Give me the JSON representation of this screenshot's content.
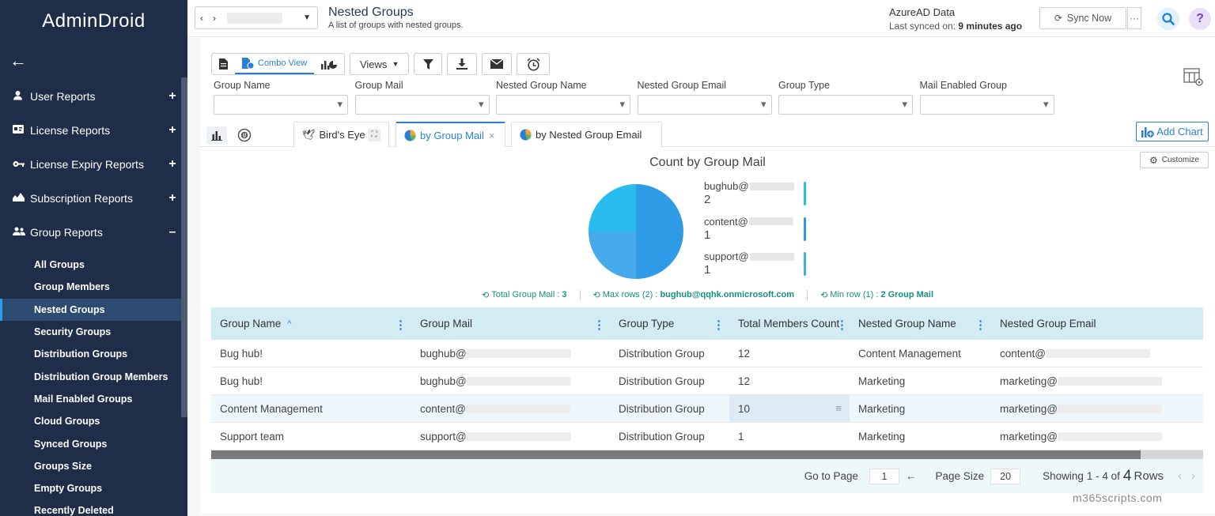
{
  "app": {
    "logo": "AdminDroid",
    "back_icon": "arrow-left-icon"
  },
  "sidebar": {
    "categories": [
      {
        "label": "User Reports",
        "icon": "user-icon",
        "toggle": "+"
      },
      {
        "label": "License Reports",
        "icon": "license-icon",
        "toggle": "+"
      },
      {
        "label": "License Expiry Reports",
        "icon": "key-icon",
        "toggle": "+"
      },
      {
        "label": "Subscription Reports",
        "icon": "subscription-icon",
        "toggle": "+"
      },
      {
        "label": "Group Reports",
        "icon": "group-icon",
        "toggle": "–"
      }
    ],
    "group_items": [
      "All Groups",
      "Group Members",
      "Nested Groups",
      "Security Groups",
      "Distribution Groups",
      "Distribution Group Members",
      "Mail Enabled Groups",
      "Cloud Groups",
      "Synced Groups",
      "Groups Size",
      "Empty Groups",
      "Recently Deleted"
    ],
    "active_item": "Nested Groups"
  },
  "header": {
    "nav_prev": "‹",
    "nav_next": "›",
    "title": "Nested Groups",
    "subtitle": "A list of groups with nested groups.",
    "data_source": "AzureAD Data",
    "last_synced_prefix": "Last synced on:",
    "last_synced_value": "9 minutes ago",
    "sync_button": "Sync Now",
    "more_button": "···",
    "help": "?"
  },
  "toolbar": {
    "combo_view": "Combo View",
    "views": "Views"
  },
  "filters": [
    "Group Name",
    "Group Mail",
    "Nested Group Name",
    "Nested Group Email",
    "Group Type",
    "Mail Enabled Group"
  ],
  "chart_tabs": {
    "birds_eye": "Bird's Eye",
    "tab1": "by Group Mail",
    "tab2": "by Nested Group Email",
    "close": "×"
  },
  "add_chart": "Add Chart",
  "customize": "Customize",
  "chart_data": {
    "type": "pie",
    "title": "Count by Group Mail",
    "categories": [
      "bughub@",
      "content@",
      "support@"
    ],
    "values": [
      2,
      1,
      1
    ],
    "colors": [
      "#2f9be6",
      "#47aaec",
      "#28bdee"
    ],
    "legend": "right"
  },
  "stats": {
    "total_label": "Total Group Mail :",
    "total_value": "3",
    "max_label": "Max rows (2) :",
    "max_value": "bughub@qqhk.onmicrosoft.com",
    "min_label": "Min row (1) :",
    "min_value": "2 Group Mail"
  },
  "table": {
    "columns": [
      "Group Name",
      "Group Mail",
      "Group Type",
      "Total Members Count",
      "Nested Group Name",
      "Nested Group Email"
    ],
    "sort_indicator": "^",
    "rows": [
      [
        "Bug hub!",
        "bughub@",
        "Distribution Group",
        "12",
        "Content Management",
        "content@"
      ],
      [
        "Bug hub!",
        "bughub@",
        "Distribution Group",
        "12",
        "Marketing",
        "marketing@"
      ],
      [
        "Content Management",
        "content@",
        "Distribution Group",
        "10",
        "Marketing",
        "marketing@"
      ],
      [
        "Support team",
        "support@",
        "Distribution Group",
        "1",
        "Marketing",
        "marketing@"
      ]
    ]
  },
  "footer": {
    "go_to_page": "Go to Page",
    "page": "1",
    "page_size_label": "Page Size",
    "page_size": "20",
    "showing": "Showing",
    "range": "1 - 4 of",
    "total": "4",
    "rows_label": "Rows",
    "prev": "‹",
    "next": "›",
    "go_arrow": "←"
  },
  "watermark": "m365scripts.com"
}
